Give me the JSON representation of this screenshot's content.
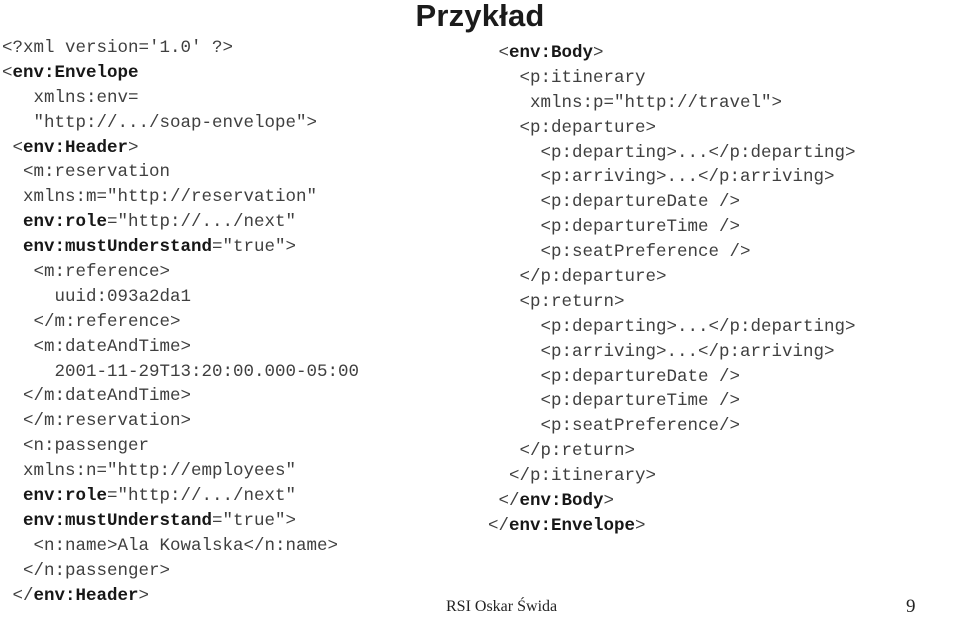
{
  "slide": {
    "title": "Przykład",
    "page_number": "9",
    "footer_author": "RSI Oskar Świda",
    "background_color": "#ffffff",
    "text_color": "#3a3a3a",
    "bold_text_color": "#171717"
  },
  "code_left": {
    "name": "soap-envelope-header-listing",
    "lines": [
      [
        {
          "t": "<?xml version='1.0' ?>",
          "bold": false
        }
      ],
      [
        {
          "t": "<",
          "bold": false
        },
        {
          "t": "env:Envelope",
          "bold": true
        }
      ],
      [
        {
          "t": "   xmlns:env=",
          "bold": false
        }
      ],
      [
        {
          "t": "   \"http://.../soap-envelope\">",
          "bold": false
        }
      ],
      [
        {
          "t": " <",
          "bold": false
        },
        {
          "t": "env:Header",
          "bold": true
        },
        {
          "t": ">",
          "bold": false
        }
      ],
      [
        {
          "t": "  <m:reservation",
          "bold": false
        }
      ],
      [
        {
          "t": "  xmlns:m=\"http://reservation\"",
          "bold": false
        }
      ],
      [
        {
          "t": "  ",
          "bold": false
        },
        {
          "t": "env:role",
          "bold": true
        },
        {
          "t": "=\"http://.../next\"",
          "bold": false
        }
      ],
      [
        {
          "t": "  ",
          "bold": false
        },
        {
          "t": "env:mustUnderstand",
          "bold": true
        },
        {
          "t": "=\"true\">",
          "bold": false
        }
      ],
      [
        {
          "t": "   <m:reference>",
          "bold": false
        }
      ],
      [
        {
          "t": "     uuid:093a2da1",
          "bold": false
        }
      ],
      [
        {
          "t": "   </m:reference>",
          "bold": false
        }
      ],
      [
        {
          "t": "   <m:dateAndTime>",
          "bold": false
        }
      ],
      [
        {
          "t": "     2001-11-29T13:20:00.000-05:00",
          "bold": false
        }
      ],
      [
        {
          "t": "  </m:dateAndTime>",
          "bold": false
        }
      ],
      [
        {
          "t": "  </m:reservation>",
          "bold": false
        }
      ],
      [
        {
          "t": "  <n:passenger",
          "bold": false
        }
      ],
      [
        {
          "t": "  xmlns:n=\"http://employees\"",
          "bold": false
        }
      ],
      [
        {
          "t": "  ",
          "bold": false
        },
        {
          "t": "env:role",
          "bold": true
        },
        {
          "t": "=\"http://.../next\"",
          "bold": false
        }
      ],
      [
        {
          "t": "  ",
          "bold": false
        },
        {
          "t": "env:mustUnderstand",
          "bold": true
        },
        {
          "t": "=\"true\">",
          "bold": false
        }
      ],
      [
        {
          "t": "   <n:name>Ala Kowalska</n:name>",
          "bold": false
        }
      ],
      [
        {
          "t": "  </n:passenger>",
          "bold": false
        }
      ],
      [
        {
          "t": " </",
          "bold": false
        },
        {
          "t": "env:Header",
          "bold": true
        },
        {
          "t": ">",
          "bold": false
        }
      ]
    ]
  },
  "code_right": {
    "name": "soap-body-listing",
    "lines": [
      [
        {
          "t": " <",
          "bold": false
        },
        {
          "t": "env:Body",
          "bold": true
        },
        {
          "t": ">",
          "bold": false
        }
      ],
      [
        {
          "t": "   <p:itinerary",
          "bold": false
        }
      ],
      [
        {
          "t": "    xmlns:p=\"http://travel\">",
          "bold": false
        }
      ],
      [
        {
          "t": "   <p:departure>",
          "bold": false
        }
      ],
      [
        {
          "t": "     <p:departing>...</p:departing>",
          "bold": false
        }
      ],
      [
        {
          "t": "     <p:arriving>...</p:arriving>",
          "bold": false
        }
      ],
      [
        {
          "t": "     <p:departureDate />",
          "bold": false
        }
      ],
      [
        {
          "t": "     <p:departureTime />",
          "bold": false
        }
      ],
      [
        {
          "t": "     <p:seatPreference />",
          "bold": false
        }
      ],
      [
        {
          "t": "   </p:departure>",
          "bold": false
        }
      ],
      [
        {
          "t": "   <p:return>",
          "bold": false
        }
      ],
      [
        {
          "t": "     <p:departing>...</p:departing>",
          "bold": false
        }
      ],
      [
        {
          "t": "     <p:arriving>...</p:arriving>",
          "bold": false
        }
      ],
      [
        {
          "t": "     <p:departureDate />",
          "bold": false
        }
      ],
      [
        {
          "t": "     <p:departureTime />",
          "bold": false
        }
      ],
      [
        {
          "t": "     <p:seatPreference/>",
          "bold": false
        }
      ],
      [
        {
          "t": "   </p:return>",
          "bold": false
        }
      ],
      [
        {
          "t": "  </p:itinerary>",
          "bold": false
        }
      ],
      [
        {
          "t": " </",
          "bold": false
        },
        {
          "t": "env:Body",
          "bold": true
        },
        {
          "t": ">",
          "bold": false
        }
      ],
      [
        {
          "t": "</",
          "bold": false
        },
        {
          "t": "env:Envelope",
          "bold": true
        },
        {
          "t": ">",
          "bold": false
        }
      ]
    ]
  }
}
